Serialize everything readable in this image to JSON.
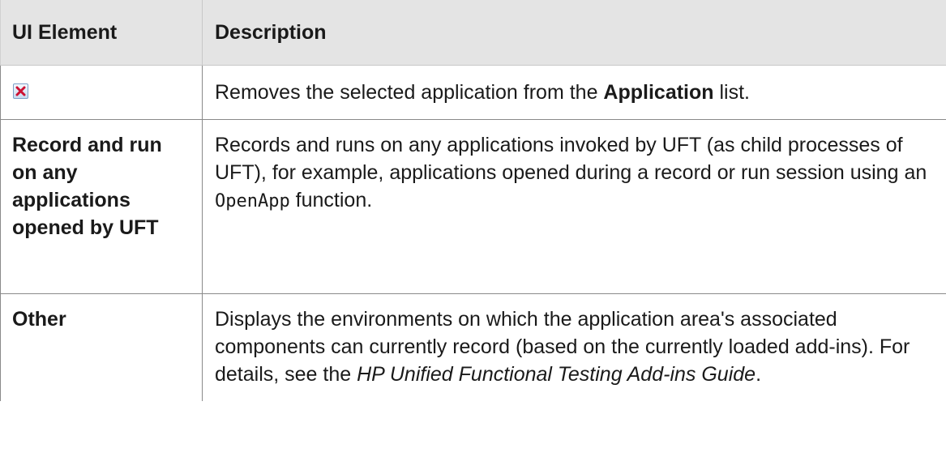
{
  "table": {
    "headers": {
      "ui_element": "UI Element",
      "description": "Description"
    },
    "rows": [
      {
        "icon": "remove-x-icon",
        "description_parts": [
          "Removes the selected application from the ",
          "Application",
          " list."
        ]
      },
      {
        "element": "Record and run on any applications opened by UFT",
        "description_parts": [
          "Records and runs on any applications invoked by UFT (as child processes of UFT), for example, applications opened during a record or run session using an ",
          "OpenApp",
          " function."
        ]
      },
      {
        "element": "Other",
        "description_parts": [
          "Displays the environments on which the application area's associated components can currently record (based on the currently loaded add-ins). For details, see the ",
          "HP Unified Functional Testing Add-ins Guide",
          "."
        ]
      }
    ]
  },
  "colors": {
    "header_bg": "#e4e4e4",
    "icon_x": "#cc1133"
  }
}
